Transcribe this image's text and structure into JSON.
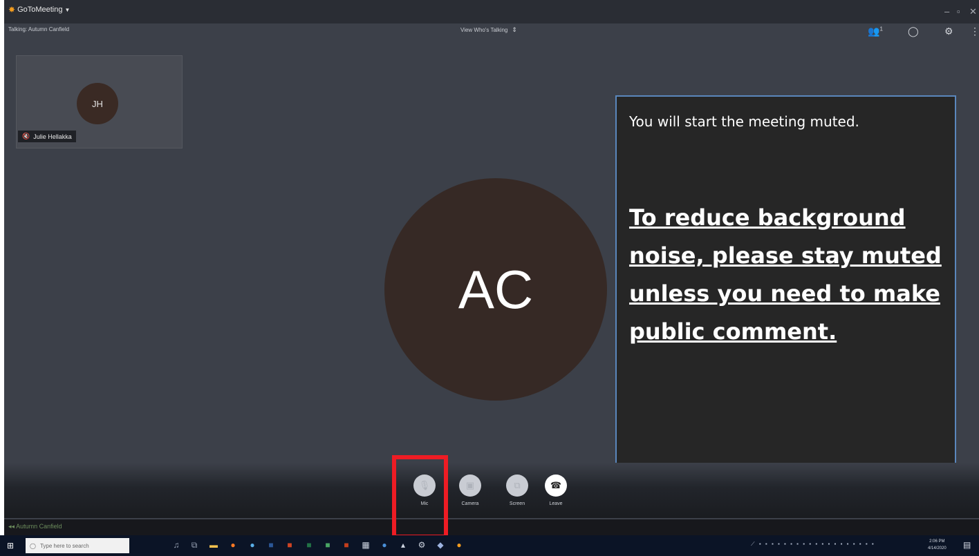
{
  "app": {
    "brand": "GoToMeeting",
    "talking_label": "Talking: Autumn Canfield",
    "view_mode": "View Who's Talking",
    "top_icons": {
      "attendees_count": "1"
    }
  },
  "participants": {
    "thumbnail": {
      "initials": "JH",
      "name": "Julie Hellakka"
    },
    "active_speaker": {
      "initials": "AC"
    }
  },
  "notice": {
    "line1": "You will start the meeting muted.",
    "line2": "To reduce background noise, please stay muted unless you need to make public comment."
  },
  "controls": {
    "mic": "Mic",
    "camera": "Camera",
    "screen": "Screen",
    "leave": "Leave"
  },
  "status": {
    "speaker_name": "Autumn Canfield"
  },
  "taskbar": {
    "search_placeholder": "Type here to search",
    "time": "2:06 PM",
    "date": "4/14/2020"
  },
  "colors": {
    "highlight": "#ee1c24",
    "notice_border": "#5a87bd",
    "background": "#3c4049"
  }
}
